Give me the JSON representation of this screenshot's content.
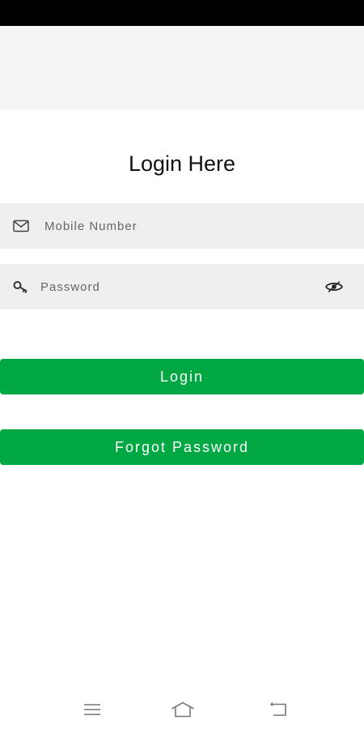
{
  "screen": {
    "title": "Login Here"
  },
  "form": {
    "mobile": {
      "placeholder": "Mobile Number",
      "value": "",
      "icon": "mail-icon"
    },
    "password": {
      "placeholder": "Password",
      "value": "",
      "icon": "key-icon",
      "toggle_icon": "eye-icon"
    }
  },
  "actions": {
    "login_label": "Login",
    "forgot_label": "Forgot Password"
  },
  "nav": {
    "items": [
      "menu-icon",
      "home-icon",
      "back-icon"
    ]
  },
  "colors": {
    "accent": "#00a843",
    "field_bg": "#efefef",
    "app_bar_bg": "#f5f5f5",
    "status_bar_bg": "#000000"
  }
}
